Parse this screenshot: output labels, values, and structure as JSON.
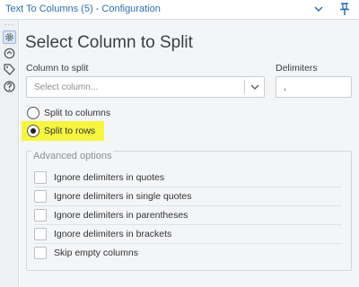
{
  "window": {
    "title": "Text To Columns (5) - Configuration"
  },
  "rail": {
    "icons": [
      "gear-icon",
      "sync-icon",
      "tag-icon",
      "help-icon"
    ]
  },
  "main": {
    "heading": "Select Column to Split",
    "column_to_split": {
      "label": "Column to split",
      "placeholder": "Select column..."
    },
    "delimiters": {
      "label": "Delimiters",
      "value": ","
    },
    "split_mode": {
      "options": [
        {
          "label": "Split to columns",
          "selected": false
        },
        {
          "label": "Split to rows",
          "selected": true
        }
      ]
    },
    "advanced": {
      "title": "Advanced options",
      "options": [
        {
          "label": "Ignore delimiters in quotes",
          "checked": false
        },
        {
          "label": "Ignore delimiters in single quotes",
          "checked": false
        },
        {
          "label": "Ignore delimiters in parentheses",
          "checked": false
        },
        {
          "label": "Ignore delimiters in brackets",
          "checked": false
        },
        {
          "label": "Skip empty columns",
          "checked": false
        }
      ]
    }
  },
  "colors": {
    "title_blue": "#2f6fb0",
    "highlight": "#f6f540",
    "panel_bg": "#f4f5f7"
  }
}
